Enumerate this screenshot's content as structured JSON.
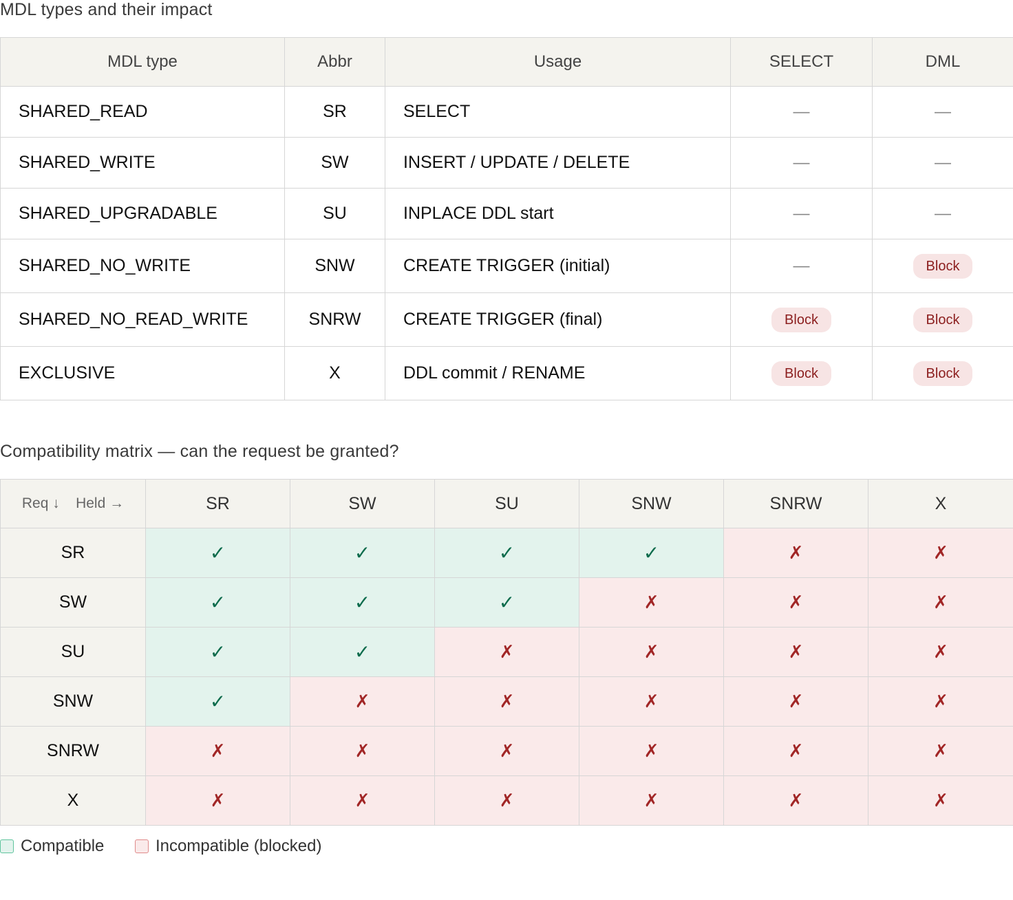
{
  "section1_title": "MDL types and their impact",
  "types_table": {
    "headers": [
      "MDL type",
      "Abbr",
      "Usage",
      "SELECT",
      "DML"
    ],
    "rows": [
      {
        "name": "SHARED_READ",
        "abbr": "SR",
        "usage": "SELECT",
        "select": "—",
        "dml": "—"
      },
      {
        "name": "SHARED_WRITE",
        "abbr": "SW",
        "usage": "INSERT / UPDATE / DELETE",
        "select": "—",
        "dml": "—"
      },
      {
        "name": "SHARED_UPGRADABLE",
        "abbr": "SU",
        "usage": "INPLACE DDL start",
        "select": "—",
        "dml": "—"
      },
      {
        "name": "SHARED_NO_WRITE",
        "abbr": "SNW",
        "usage": "CREATE TRIGGER (initial)",
        "select": "—",
        "dml": "Block"
      },
      {
        "name": "SHARED_NO_READ_WRITE",
        "abbr": "SNRW",
        "usage": "CREATE TRIGGER (final)",
        "select": "Block",
        "dml": "Block"
      },
      {
        "name": "EXCLUSIVE",
        "abbr": "X",
        "usage": "DDL commit / RENAME",
        "select": "Block",
        "dml": "Block"
      }
    ]
  },
  "section2_title": "Compatibility matrix — can the request be granted?",
  "matrix": {
    "corner_req": "Req ↓",
    "corner_held": "Held →",
    "columns": [
      "SR",
      "SW",
      "SU",
      "SNW",
      "SNRW",
      "X"
    ],
    "rows": [
      {
        "label": "SR",
        "cells": [
          "✓",
          "✓",
          "✓",
          "✓",
          "✗",
          "✗"
        ]
      },
      {
        "label": "SW",
        "cells": [
          "✓",
          "✓",
          "✓",
          "✗",
          "✗",
          "✗"
        ]
      },
      {
        "label": "SU",
        "cells": [
          "✓",
          "✓",
          "✗",
          "✗",
          "✗",
          "✗"
        ]
      },
      {
        "label": "SNW",
        "cells": [
          "✓",
          "✗",
          "✗",
          "✗",
          "✗",
          "✗"
        ]
      },
      {
        "label": "SNRW",
        "cells": [
          "✗",
          "✗",
          "✗",
          "✗",
          "✗",
          "✗"
        ]
      },
      {
        "label": "X",
        "cells": [
          "✗",
          "✗",
          "✗",
          "✗",
          "✗",
          "✗"
        ]
      }
    ]
  },
  "legend": {
    "compatible": "Compatible",
    "incompatible": "Incompatible (blocked)"
  },
  "colors": {
    "compatible_bg": "#e3f3ed",
    "compatible_fg": "#0c6b4c",
    "incompatible_bg": "#faeaea",
    "incompatible_fg": "#a12626",
    "header_bg": "#f4f3ee"
  }
}
